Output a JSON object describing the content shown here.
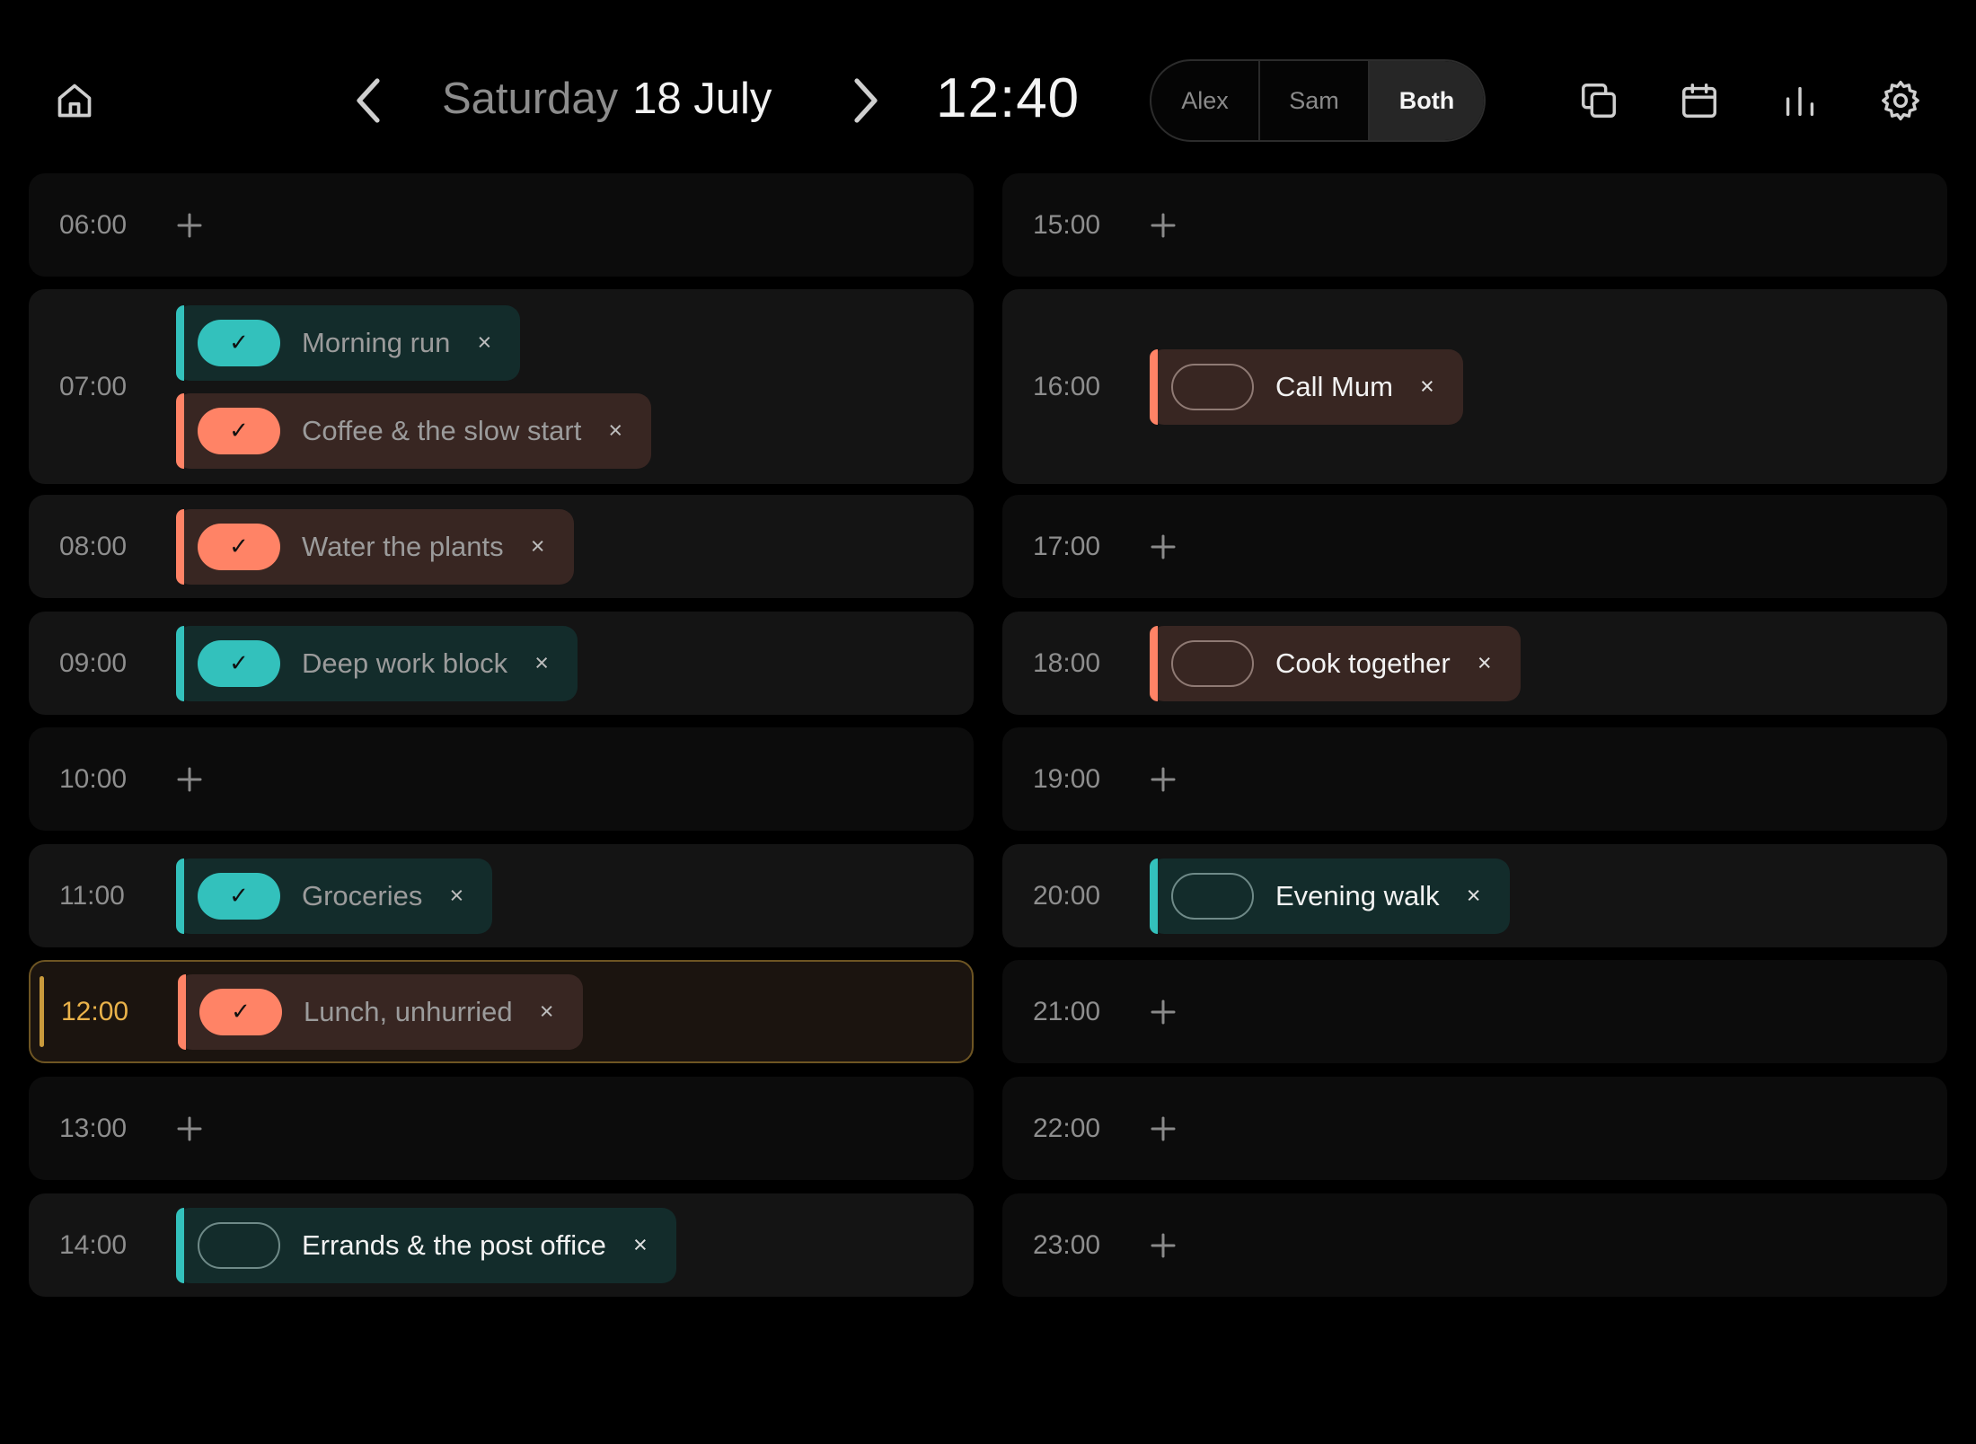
{
  "header": {
    "weekday": "Saturday",
    "date": "18 July",
    "clock": "12:40",
    "filter": {
      "options": [
        "Alex",
        "Sam",
        "Both"
      ],
      "selected": "Both"
    },
    "icons": {
      "home": "home-icon",
      "prev": "chevron-left-icon",
      "next": "chevron-right-icon",
      "copy": "copy-icon",
      "calendar": "calendar-icon",
      "stats": "bar-chart-icon",
      "settings": "gear-icon"
    }
  },
  "colors": {
    "teal": "#33c1bc",
    "coral": "#ff8366",
    "current_hour": "#e9b24a"
  },
  "left_column": [
    {
      "time": "06:00",
      "events": []
    },
    {
      "time": "07:00",
      "events": [
        {
          "title": "Morning run",
          "color": "teal",
          "done": true
        },
        {
          "title": "Coffee & the slow start",
          "color": "coral",
          "done": true
        }
      ]
    },
    {
      "time": "08:00",
      "events": [
        {
          "title": "Water the plants",
          "color": "coral",
          "done": true
        }
      ]
    },
    {
      "time": "09:00",
      "events": [
        {
          "title": "Deep work block",
          "color": "teal",
          "done": true
        }
      ]
    },
    {
      "time": "10:00",
      "events": []
    },
    {
      "time": "11:00",
      "events": [
        {
          "title": "Groceries",
          "color": "teal",
          "done": true
        }
      ]
    },
    {
      "time": "12:00",
      "current": true,
      "events": [
        {
          "title": "Lunch, unhurried",
          "color": "coral",
          "done": true
        }
      ]
    },
    {
      "time": "13:00",
      "events": []
    },
    {
      "time": "14:00",
      "events": [
        {
          "title": "Errands & the post office",
          "color": "teal",
          "done": false
        }
      ]
    }
  ],
  "right_column": [
    {
      "time": "15:00",
      "events": []
    },
    {
      "time": "16:00",
      "events": [
        {
          "title": "Call Mum",
          "color": "coral",
          "done": false
        }
      ]
    },
    {
      "time": "17:00",
      "events": []
    },
    {
      "time": "18:00",
      "events": [
        {
          "title": "Cook together",
          "color": "coral",
          "done": false
        }
      ]
    },
    {
      "time": "19:00",
      "events": []
    },
    {
      "time": "20:00",
      "events": [
        {
          "title": "Evening walk",
          "color": "teal",
          "done": false
        }
      ]
    },
    {
      "time": "21:00",
      "events": []
    },
    {
      "time": "22:00",
      "events": []
    },
    {
      "time": "23:00",
      "events": []
    }
  ],
  "glyphs": {
    "check": "✓",
    "close": "×"
  }
}
